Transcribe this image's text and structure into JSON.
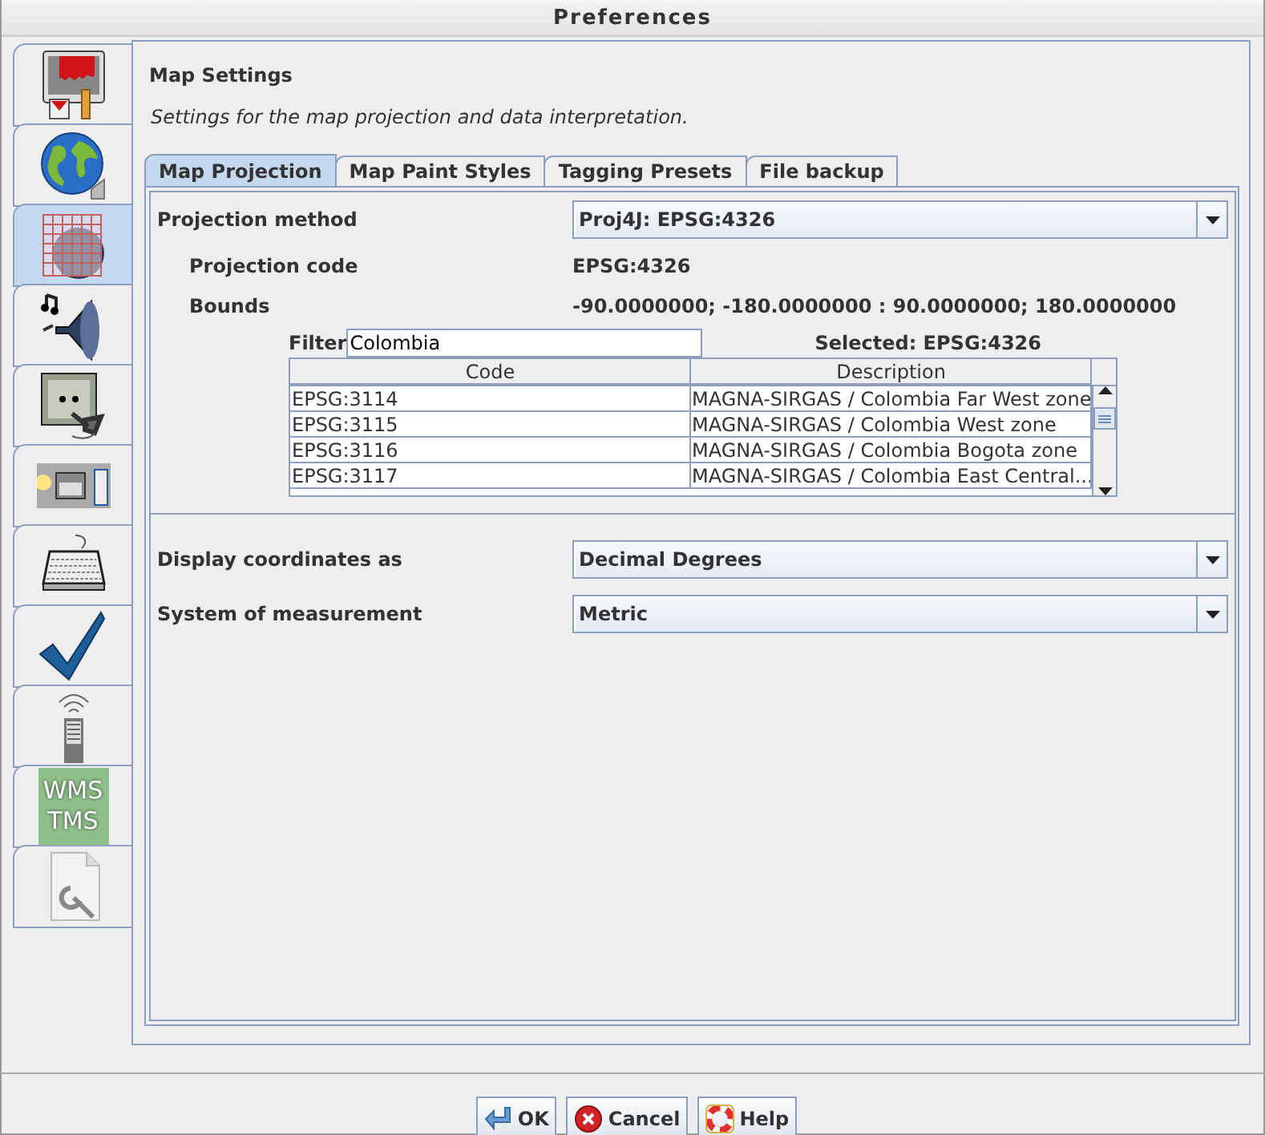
{
  "window": {
    "title": "Preferences"
  },
  "sidebar": {
    "items": [
      {
        "kind": "display",
        "selected": false
      },
      {
        "kind": "map",
        "selected": false
      },
      {
        "kind": "projection",
        "selected": true
      },
      {
        "kind": "audio",
        "selected": false
      },
      {
        "kind": "plugin",
        "selected": false
      },
      {
        "kind": "toolbar",
        "selected": false
      },
      {
        "kind": "keyboard",
        "selected": false
      },
      {
        "kind": "validator",
        "selected": false
      },
      {
        "kind": "remote",
        "selected": false
      },
      {
        "kind": "imagery",
        "label_lines": [
          "WMS",
          "TMS"
        ],
        "selected": false
      },
      {
        "kind": "advanced",
        "selected": false
      }
    ]
  },
  "section": {
    "title": "Map Settings",
    "description": "Settings for the map projection and data interpretation."
  },
  "tabs": [
    {
      "label": "Map Projection",
      "selected": true
    },
    {
      "label": "Map Paint Styles",
      "selected": false
    },
    {
      "label": "Tagging Presets",
      "selected": false
    },
    {
      "label": "File backup",
      "selected": false
    }
  ],
  "projection": {
    "method_label": "Projection method",
    "method_value": "Proj4J: EPSG:4326",
    "code_label": "Projection code",
    "code_value": "EPSG:4326",
    "bounds_label": "Bounds",
    "bounds_value": "-90.0000000; -180.0000000 : 90.0000000; 180.0000000",
    "filter_label": "Filter",
    "filter_value": "Colombia",
    "selected_text": "Selected: EPSG:4326"
  },
  "table": {
    "columns": [
      "Code",
      "Description"
    ],
    "rows": [
      [
        "EPSG:3114",
        "MAGNA-SIRGAS / Colombia Far West zone"
      ],
      [
        "EPSG:3115",
        "MAGNA-SIRGAS / Colombia West zone"
      ],
      [
        "EPSG:3116",
        "MAGNA-SIRGAS / Colombia Bogota zone"
      ],
      [
        "EPSG:3117",
        "MAGNA-SIRGAS / Colombia East Central..."
      ]
    ]
  },
  "settings": [
    {
      "label": "Display coordinates as",
      "value": "Decimal Degrees"
    },
    {
      "label": "System of measurement",
      "value": "Metric"
    }
  ],
  "buttons": [
    {
      "kind": "ok",
      "label": "OK"
    },
    {
      "kind": "cancel",
      "label": "Cancel"
    },
    {
      "kind": "help",
      "label": "Help"
    }
  ]
}
